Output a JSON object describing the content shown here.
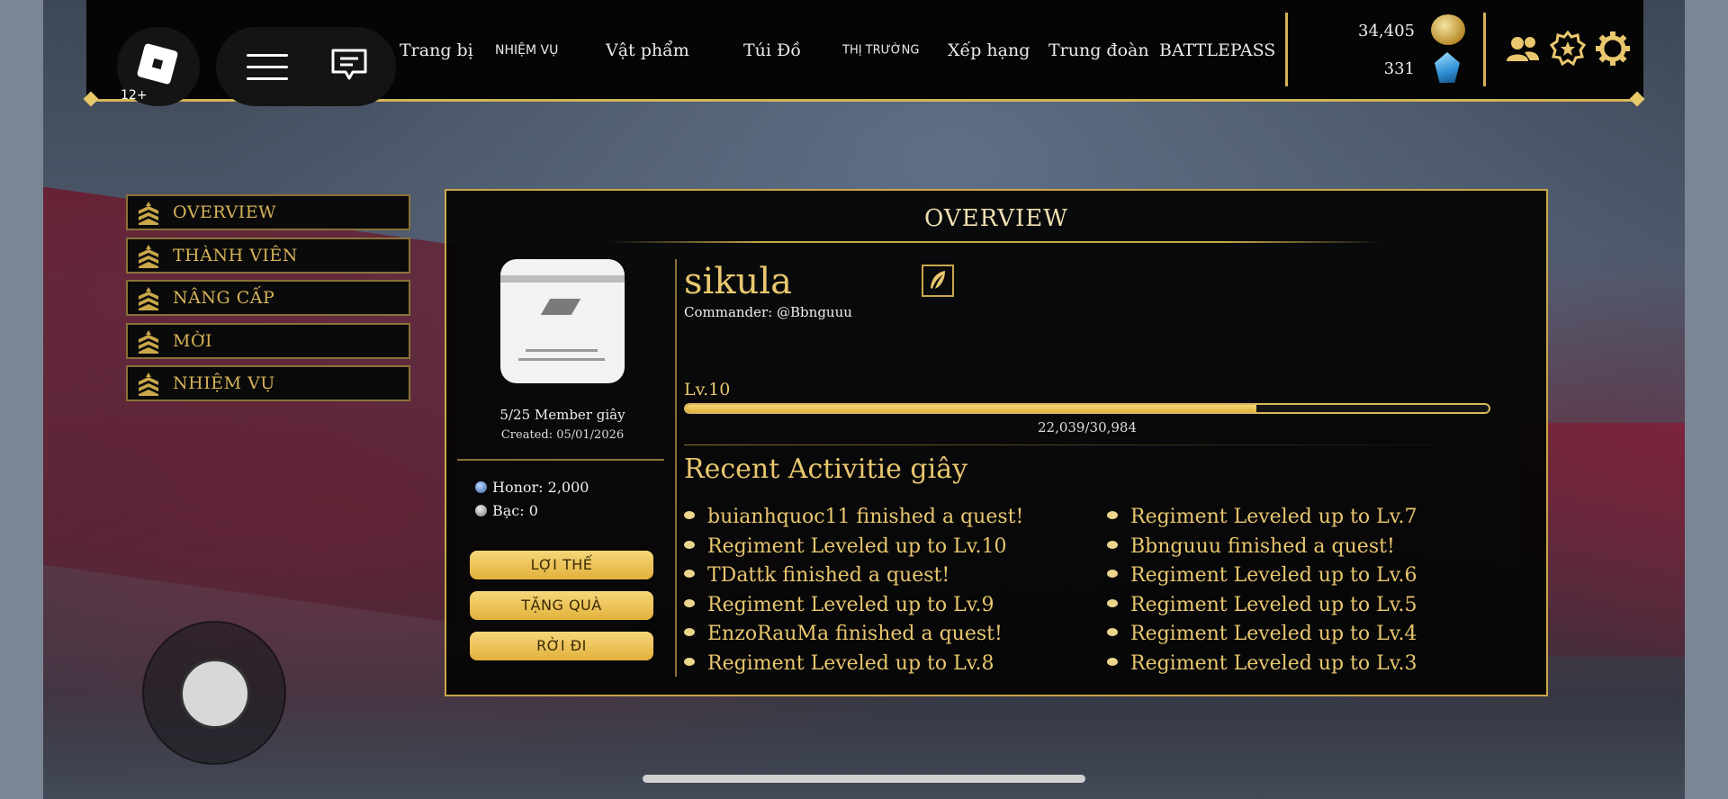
{
  "topbar": {
    "age_rating": "12+",
    "nav": [
      "Trang bị",
      "NHIỆM VỤ",
      "Vật phẩm",
      "Túi Đồ",
      "THỊ TRƯỜNG",
      "Xếp hạng",
      "Trung đoàn",
      "BATTLEPASS"
    ],
    "gold": "34,405",
    "gems": "331"
  },
  "sidebar": {
    "items": [
      {
        "label": "OVERVIEW"
      },
      {
        "label": "THÀNH VIÊN"
      },
      {
        "label": "NÂNG CẤP"
      },
      {
        "label": "MỜI"
      },
      {
        "label": "NHIỆM VỤ"
      }
    ]
  },
  "panel": {
    "title": "OVERVIEW",
    "members": "5/25 Member giây",
    "created": "Created: 05/01/2026",
    "honor": "Honor: 2,000",
    "silver": "Bạc: 0",
    "buttons": [
      "LỢI THẾ",
      "TẶNG QUÀ",
      "RỜI ĐI"
    ],
    "regiment_name": "sikula",
    "commander": "Commander: @Bbnguuu",
    "level": "Lv.10",
    "xp_text": "22,039/30,984",
    "xp_fraction": 0.7113,
    "recent_title": "Recent Activitie giây",
    "activities_left": [
      "buianhquoc11 finished a quest!",
      "Regiment Leveled up to Lv.10",
      "TDattk finished a quest!",
      "Regiment Leveled up to Lv.9",
      "EnzoRauMa finished a quest!",
      "Regiment Leveled up to Lv.8"
    ],
    "activities_right": [
      "Regiment Leveled up to Lv.7",
      "Bbnguuu finished a quest!",
      "Regiment Leveled up to Lv.6",
      "Regiment Leveled up to Lv.5",
      "Regiment Leveled up to Lv.4",
      "Regiment Leveled up to Lv.3"
    ]
  },
  "colors": {
    "gold": "#e8c76e",
    "panel_border": "#c9a74a",
    "button": "#f6d77a"
  },
  "icons": [
    "roblox-logo-icon",
    "hamburger-menu-icon",
    "chat-icon",
    "gold-coin-icon",
    "gem-icon",
    "friends-icon",
    "badge-icon",
    "settings-gear-icon",
    "chevron-rank-icon",
    "quill-edit-icon"
  ]
}
